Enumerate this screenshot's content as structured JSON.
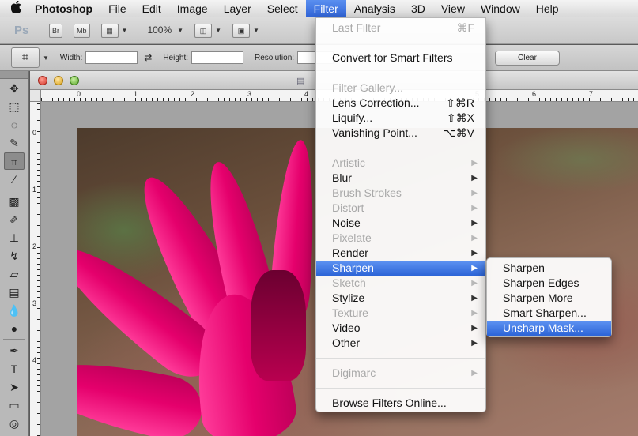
{
  "menubar": {
    "apple": "",
    "app_name": "Photoshop",
    "items": [
      "File",
      "Edit",
      "Image",
      "Layer",
      "Select",
      "Filter",
      "Analysis",
      "3D",
      "View",
      "Window",
      "Help"
    ],
    "active_item": "Filter"
  },
  "appbar": {
    "logo": "Ps",
    "bridge_label": "Br",
    "minibridge_label": "Mb",
    "zoom": "100%"
  },
  "options": {
    "width_label": "Width:",
    "height_label": "Height:",
    "resolution_label": "Resolution:",
    "width_value": "",
    "height_value": "",
    "resolution_value": "",
    "clear_label": "Clear"
  },
  "rulers": {
    "h_ticks": [
      "0",
      "1",
      "2",
      "3",
      "4",
      "5",
      "6",
      "7"
    ],
    "v_ticks": [
      "0",
      "1",
      "2",
      "3",
      "4"
    ]
  },
  "filter_menu": {
    "last_filter": "Last Filter",
    "last_filter_shortcut": "⌘F",
    "convert": "Convert for Smart Filters",
    "gallery": "Filter Gallery...",
    "lens": "Lens Correction...",
    "lens_shortcut": "⇧⌘R",
    "liquify": "Liquify...",
    "liquify_shortcut": "⇧⌘X",
    "vanishing": "Vanishing Point...",
    "vanishing_shortcut": "⌥⌘V",
    "artistic": "Artistic",
    "blur": "Blur",
    "brush": "Brush Strokes",
    "distort": "Distort",
    "noise": "Noise",
    "pixelate": "Pixelate",
    "render": "Render",
    "sharpen": "Sharpen",
    "sketch": "Sketch",
    "stylize": "Stylize",
    "texture": "Texture",
    "video": "Video",
    "other": "Other",
    "digimarc": "Digimarc",
    "browse": "Browse Filters Online..."
  },
  "sharpen_menu": {
    "sharpen": "Sharpen",
    "edges": "Sharpen Edges",
    "more": "Sharpen More",
    "smart": "Smart Sharpen...",
    "unsharp": "Unsharp Mask..."
  },
  "colors": {
    "highlight": "#2f63d6",
    "flower": "#e5006c"
  }
}
